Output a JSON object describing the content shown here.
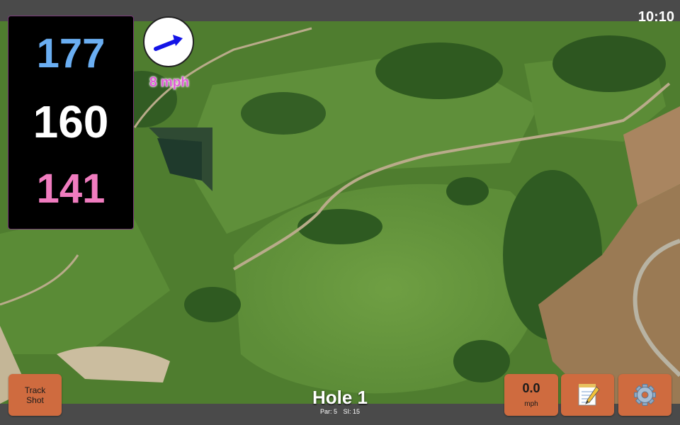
{
  "status": {
    "time": "10:10"
  },
  "yardages": {
    "back": "177",
    "center": "160",
    "front": "141"
  },
  "colors": {
    "back": "#6aaef2",
    "center": "#ffffff",
    "front": "#f07cbf",
    "button": "#cf6b3f"
  },
  "wind": {
    "speed": "8 mph",
    "icon": "wind-arrow-icon"
  },
  "hole": {
    "title": "Hole 1",
    "par": "Par: 5",
    "stroke_index": "SI: 15"
  },
  "buttons": {
    "track_shot_line1": "Track",
    "track_shot_line2": "Shot",
    "speed_value": "0.0",
    "speed_unit": "mph",
    "notes_icon": "notepad-icon",
    "settings_icon": "gear-icon"
  }
}
